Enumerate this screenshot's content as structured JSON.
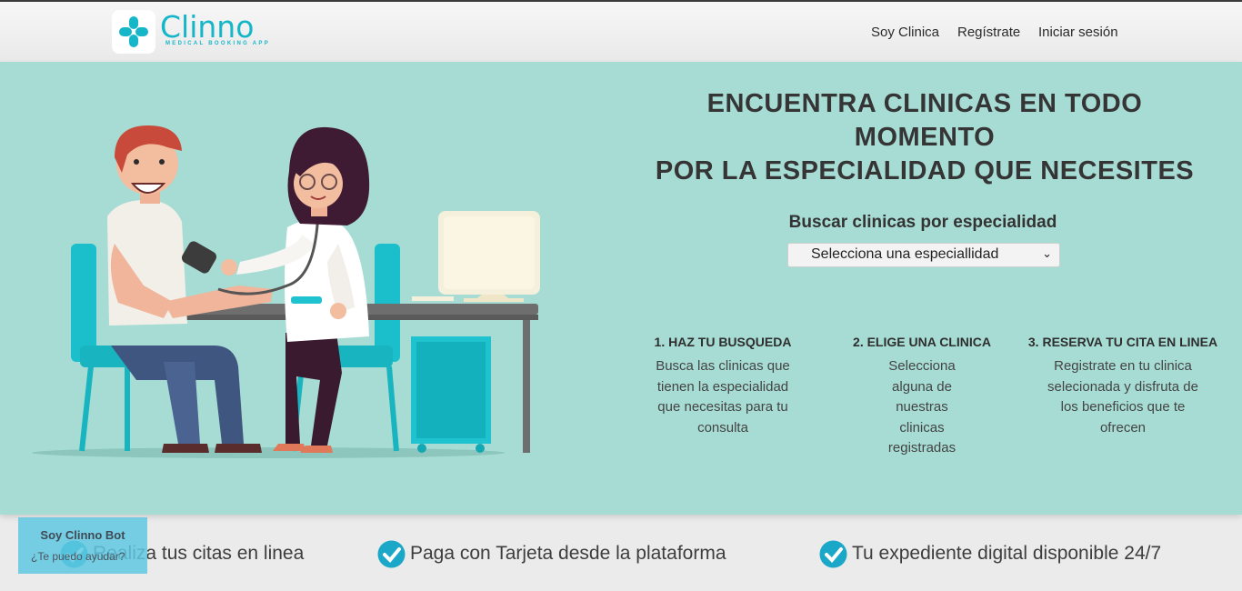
{
  "brand": {
    "name": "Clinno",
    "tagline": "MEDICAL BOOKING APP",
    "accent": "#16b6c9"
  },
  "nav": {
    "items": [
      "Soy Clinica",
      "Regístrate",
      "Iniciar sesión"
    ]
  },
  "hero": {
    "title_line1": "ENCUENTRA CLINICAS EN TODO MOMENTO",
    "title_line2": "POR LA ESPECIALIDAD QUE NECESITES",
    "search_label": "Buscar clinicas por especialidad",
    "select_value": "Selecciona una especiallidad",
    "background": "#a7dcd4"
  },
  "steps": [
    {
      "title": "1. HAZ TU BUSQUEDA",
      "text": "Busca las clinicas que tienen la especialidad que necesitas para tu consulta"
    },
    {
      "title": "2. ELIGE UNA CLINICA",
      "text": "Selecciona alguna de nuestras clinicas registradas"
    },
    {
      "title": "3. RESERVA TU CITA EN LINEA",
      "text": "Registrate en tu clinica selecionada y disfruta de los beneficios que te ofrecen"
    }
  ],
  "features": [
    {
      "icon": "check-circle-icon",
      "text": "Realiza tus citas en linea"
    },
    {
      "icon": "check-circle-icon",
      "text": "Paga con Tarjeta desde la plataforma"
    },
    {
      "icon": "check-circle-icon",
      "text": "Tu expediente digital disponible 24/7"
    }
  ],
  "chatbot": {
    "title": "Soy Clinno Bot",
    "subtitle": "¿Te puedo ayudar?"
  }
}
